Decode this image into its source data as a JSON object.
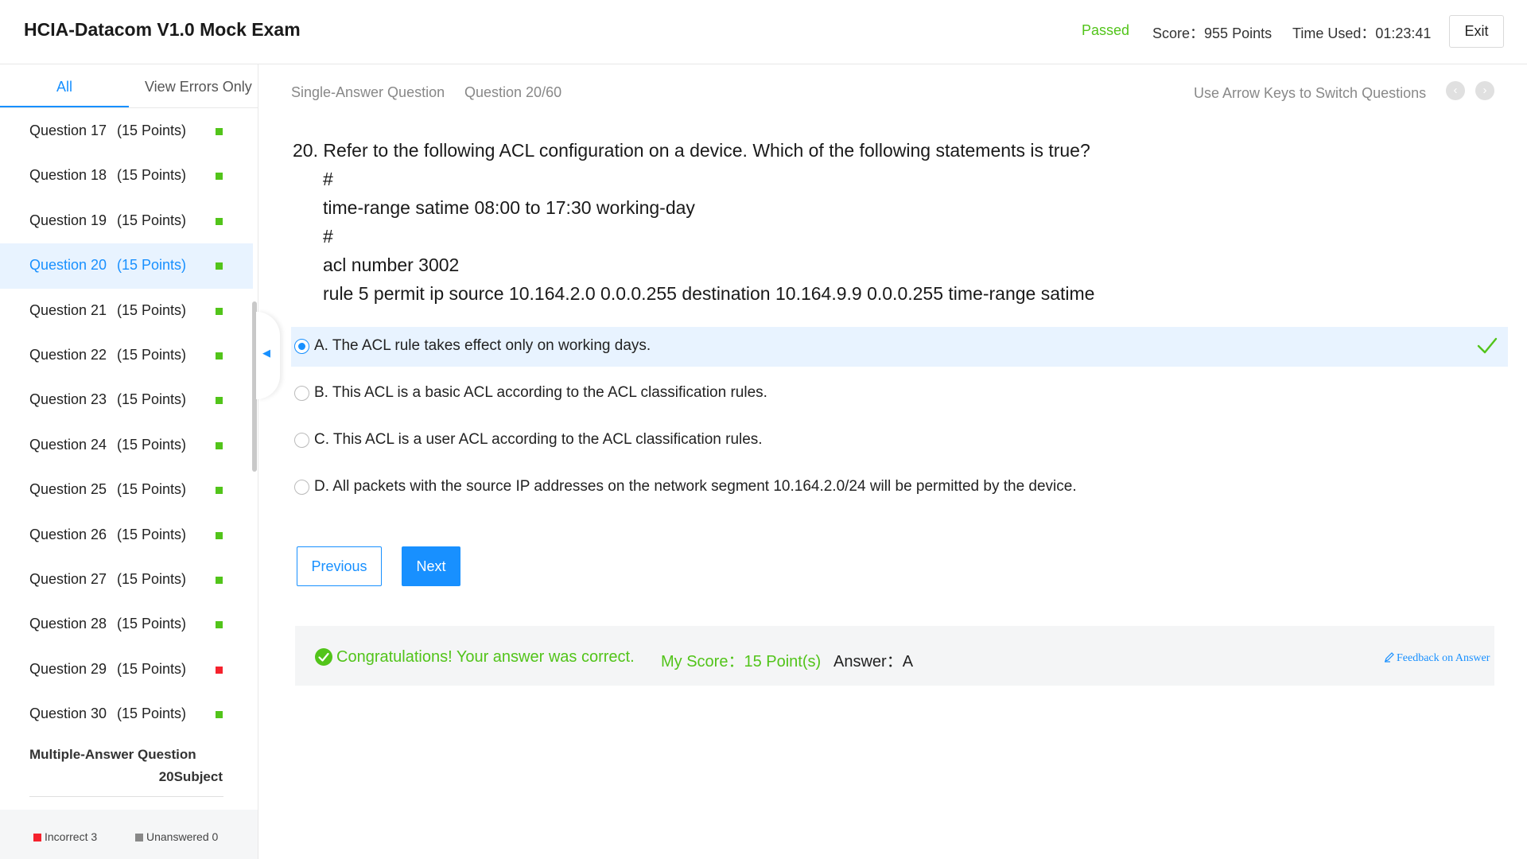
{
  "header": {
    "title": "HCIA-Datacom V1.0 Mock Exam",
    "status": "Passed",
    "score_label": "Score",
    "score_value": "955 Points",
    "time_label": "Time Used",
    "time_value": "01:23:41",
    "exit_label": "Exit"
  },
  "sidebar": {
    "tabs": {
      "all": "All",
      "errors": "View Errors Only"
    },
    "questions": [
      {
        "label": "Question 17",
        "points": "(15 Points)",
        "status": "correct"
      },
      {
        "label": "Question 18",
        "points": "(15 Points)",
        "status": "correct"
      },
      {
        "label": "Question 19",
        "points": "(15 Points)",
        "status": "correct"
      },
      {
        "label": "Question 20",
        "points": "(15 Points)",
        "status": "correct"
      },
      {
        "label": "Question 21",
        "points": "(15 Points)",
        "status": "correct"
      },
      {
        "label": "Question 22",
        "points": "(15 Points)",
        "status": "correct"
      },
      {
        "label": "Question 23",
        "points": "(15 Points)",
        "status": "correct"
      },
      {
        "label": "Question 24",
        "points": "(15 Points)",
        "status": "correct"
      },
      {
        "label": "Question 25",
        "points": "(15 Points)",
        "status": "correct"
      },
      {
        "label": "Question 26",
        "points": "(15 Points)",
        "status": "correct"
      },
      {
        "label": "Question 27",
        "points": "(15 Points)",
        "status": "correct"
      },
      {
        "label": "Question 28",
        "points": "(15 Points)",
        "status": "correct"
      },
      {
        "label": "Question 29",
        "points": "(15 Points)",
        "status": "incorrect"
      },
      {
        "label": "Question 30",
        "points": "(15 Points)",
        "status": "correct"
      }
    ],
    "section_title": "Multiple-Answer Question",
    "section_subtitle": "20Subject",
    "legend": {
      "incorrect": "Incorrect 3",
      "unanswered": "Unanswered 0"
    }
  },
  "main": {
    "question_type": "Single-Answer Question",
    "question_counter": "Question 20/60",
    "nav_hint": "Use Arrow Keys to Switch Questions",
    "question_text": "20. Refer to the following ACL configuration on a device. Which of the following statements is true?",
    "code_lines": [
      "#",
      "time-range satime 08:00 to 17:30 working-day",
      "#",
      "acl number 3002",
      "rule 5 permit ip source 10.164.2.0 0.0.0.255 destination 10.164.9.9 0.0.0.255 time-range satime"
    ],
    "options": [
      {
        "text": "A. The ACL rule takes effect only on working days.",
        "selected": true,
        "correct": true
      },
      {
        "text": "B. This ACL is a basic ACL according to the ACL classification rules.",
        "selected": false,
        "correct": false
      },
      {
        "text": "C. This ACL is a user ACL according to the ACL classification rules.",
        "selected": false,
        "correct": false
      },
      {
        "text": "D. All packets with the source IP addresses on the network segment 10.164.2.0/24 will be permitted by the device.",
        "selected": false,
        "correct": false
      }
    ],
    "buttons": {
      "previous": "Previous",
      "next": "Next"
    },
    "result": {
      "message": "Congratulations! Your answer was correct.",
      "score_label": "My Score",
      "score_value": "15 Point(s)",
      "answer_label": "Answer",
      "answer_value": "A",
      "feedback": "Feedback on Answer"
    }
  },
  "colors": {
    "accent": "#1890ff",
    "success": "#52c41a",
    "error": "#f5222d",
    "selected_bg": "#e8f3ff"
  }
}
